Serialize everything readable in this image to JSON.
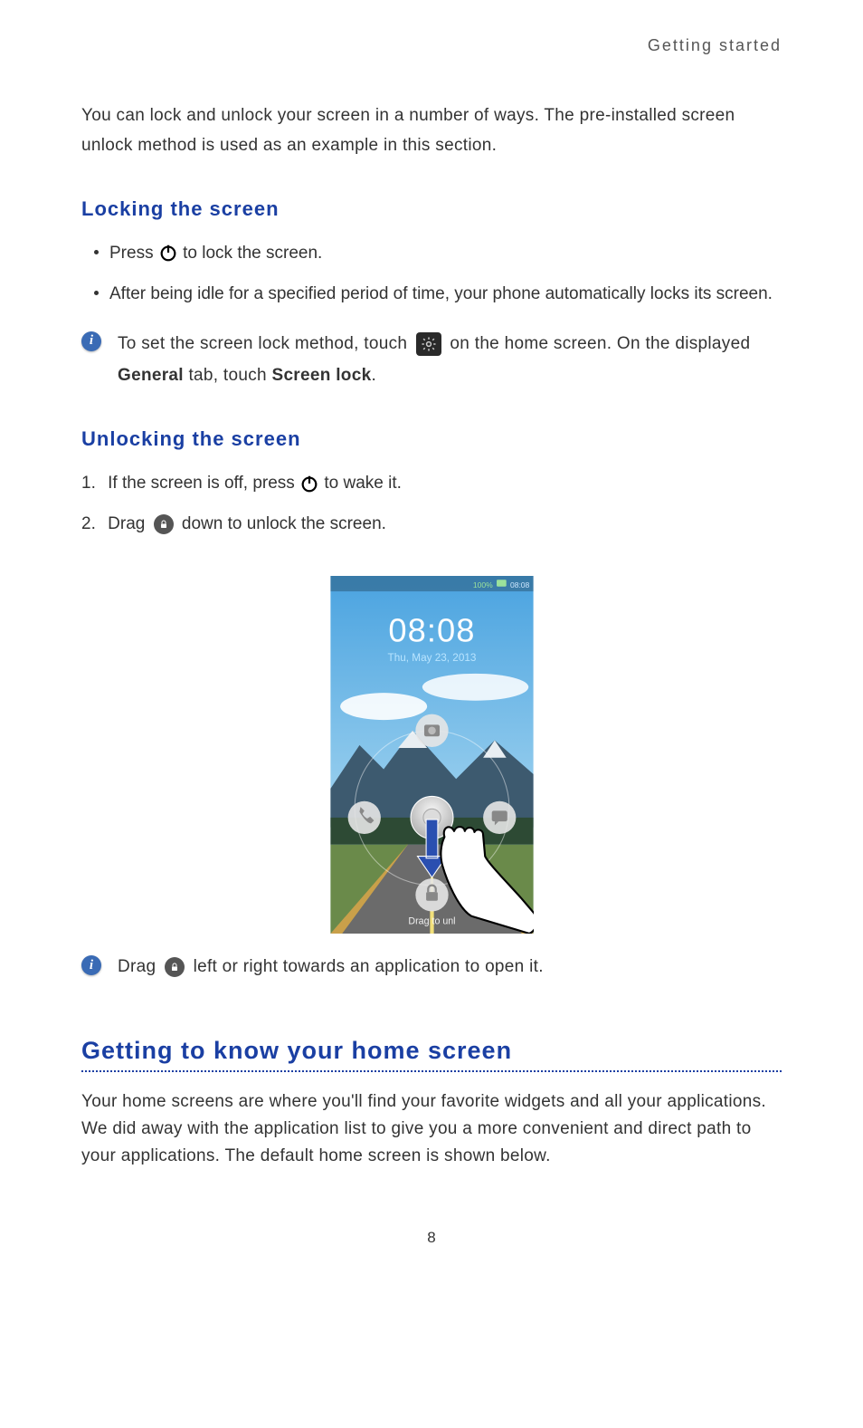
{
  "running_header": "Getting started",
  "intro_paragraph": "You can lock and unlock your screen in a number of ways. The pre-installed screen unlock method is used as an example in this section.",
  "locking": {
    "heading": "Locking  the  screen",
    "bullet1_before": "Press ",
    "bullet1_after": " to lock the screen.",
    "bullet2": "After being idle for a specified period of time, your phone automatically locks its screen.",
    "note_before": "To set the screen lock method, touch ",
    "note_mid": " on the home screen. On the displayed ",
    "note_bold1": "General",
    "note_mid2": " tab, touch ",
    "note_bold2": "Screen lock",
    "note_after": "."
  },
  "unlocking": {
    "heading": "Unlocking  the  screen",
    "step1_before": "If the screen is off, press ",
    "step1_after": " to wake it.",
    "step2_before": "Drag ",
    "step2_after": " down to unlock the screen.",
    "note_before": "Drag ",
    "note_after": " left or right towards an application to open it."
  },
  "lockscreen_figure": {
    "status_signal": "100%",
    "status_time": "08:08",
    "clock": "08:08",
    "date": "Thu, May 23, 2013",
    "hint": "Drag to unl"
  },
  "homescreen": {
    "heading": "Getting to know your home screen",
    "paragraph": "Your home screens are where you'll find your favorite widgets and all your applications. We did away with the application list to give you a more convenient and direct path to your applications. The default home screen is shown below."
  },
  "page_number": "8"
}
